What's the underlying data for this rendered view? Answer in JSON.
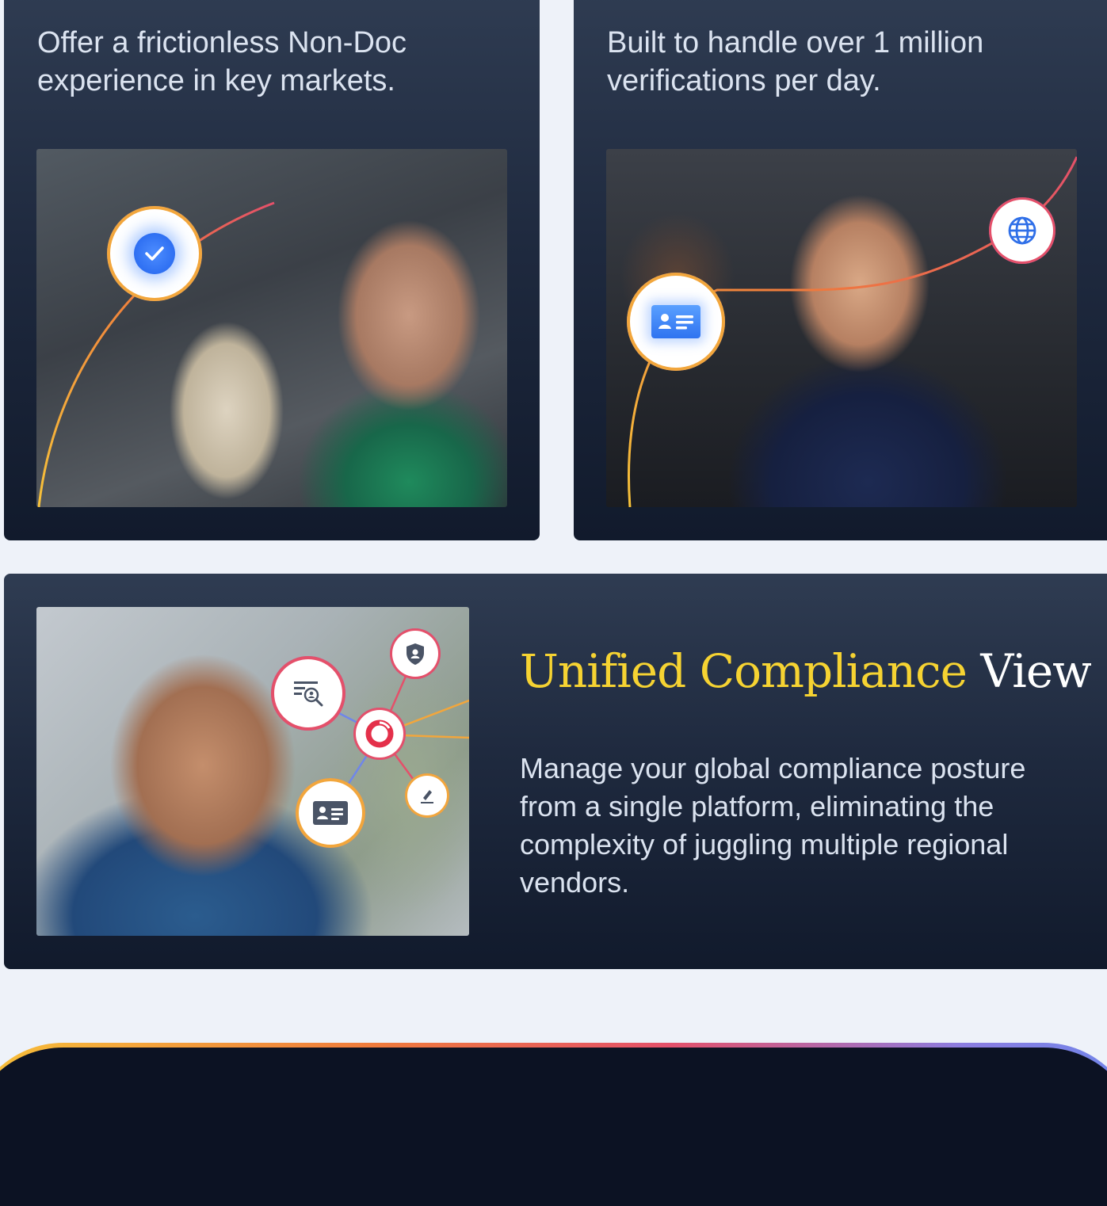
{
  "cards": {
    "non_doc": {
      "text": "Offer a frictionless Non-Doc experience in key markets."
    },
    "scale": {
      "text": "Built to handle over 1 million verifications per day."
    }
  },
  "compliance": {
    "heading_highlight": "Unified Compliance",
    "heading_rest": " View",
    "body": "Manage your global compliance posture from a single platform, eliminating the complexity of juggling multiple regional vendors."
  },
  "icons": {
    "check": "check-icon",
    "id_card": "id-card-icon",
    "globe": "globe-icon",
    "shield": "shield-user-icon",
    "search_doc": "document-search-icon",
    "hub": "hub-logo-icon",
    "signature": "signature-icon"
  },
  "colors": {
    "card_top": "#2f3c52",
    "card_bottom": "#111a2c",
    "accent_yellow": "#f6d332",
    "accent_orange": "#ef7a3c",
    "accent_red": "#e4506a",
    "accent_purple": "#8b7de0",
    "accent_blue": "#4b8ff0",
    "page_bg": "#eef2f9"
  }
}
